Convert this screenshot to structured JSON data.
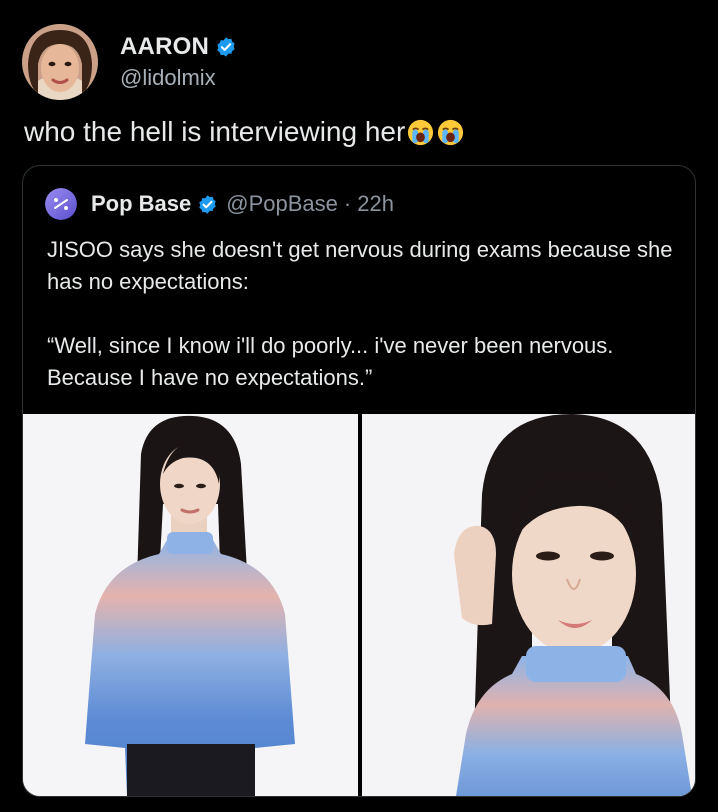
{
  "tweet": {
    "author": {
      "display_name": "AARON",
      "handle": "@lidolmix",
      "verified": true,
      "avatar": "profile-photo"
    },
    "text": "who the hell is interviewing her",
    "emojis": [
      "loudly-crying-face-emoji",
      "loudly-crying-face-emoji"
    ]
  },
  "quoted_tweet": {
    "author": {
      "display_name": "Pop Base",
      "handle": "@PopBase",
      "verified": true,
      "avatar": "pop-base-logo"
    },
    "meta_separator": "·",
    "time": "22h",
    "paragraphs": [
      "JISOO says she doesn't get nervous during exams because she has no expectations:",
      "“Well, since I know i'll do poorly... i've never been nervous. Because I have no expectations.”"
    ],
    "images": [
      {
        "name": "photo-left",
        "description_icon": "portrait-photo"
      },
      {
        "name": "photo-right",
        "description_icon": "portrait-photo"
      }
    ]
  },
  "colors": {
    "background": "#000000",
    "text_primary": "#e7e9ea",
    "text_secondary": "#8b949e",
    "verified_blue": "#1d9bf0",
    "border": "#2f3336"
  }
}
